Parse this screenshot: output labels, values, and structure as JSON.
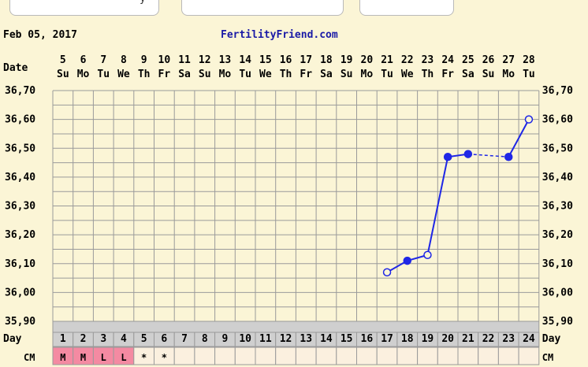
{
  "header": {
    "date": "Feb 05, 2017",
    "site": "FertilityFriend.com",
    "top_buttons": [
      {
        "label": "y"
      },
      {
        "label": ""
      },
      {
        "label": ""
      }
    ]
  },
  "chart_data": {
    "type": "line",
    "row_labels": {
      "date": "Date",
      "day": "Day",
      "cm": "CM"
    },
    "dates": [
      "5",
      "6",
      "7",
      "8",
      "9",
      "10",
      "11",
      "12",
      "13",
      "14",
      "15",
      "16",
      "17",
      "18",
      "19",
      "20",
      "21",
      "22",
      "23",
      "24",
      "25",
      "26",
      "27",
      "28"
    ],
    "weekdays": [
      "Su",
      "Mo",
      "Tu",
      "We",
      "Th",
      "Fr",
      "Sa",
      "Su",
      "Mo",
      "Tu",
      "We",
      "Th",
      "Fr",
      "Sa",
      "Su",
      "Mo",
      "Tu",
      "We",
      "Th",
      "Fr",
      "Sa",
      "Su",
      "Mo",
      "Tu"
    ],
    "days": [
      "1",
      "2",
      "3",
      "4",
      "5",
      "6",
      "7",
      "8",
      "9",
      "10",
      "11",
      "12",
      "13",
      "14",
      "15",
      "16",
      "17",
      "18",
      "19",
      "20",
      "21",
      "22",
      "23",
      "24"
    ],
    "ylim": [
      35.9,
      36.7
    ],
    "y_ticks": [
      "35,90",
      "36,00",
      "36,10",
      "36,20",
      "36,30",
      "36,40",
      "36,50",
      "36,60",
      "36,70"
    ],
    "series": [
      {
        "points": [
          {
            "day": 17,
            "temp": 36.07,
            "filled": false
          },
          {
            "day": 18,
            "temp": 36.11,
            "filled": true
          },
          {
            "day": 19,
            "temp": 36.13,
            "filled": false
          },
          {
            "day": 20,
            "temp": 36.47,
            "filled": true
          },
          {
            "day": 21,
            "temp": 36.48,
            "filled": true
          },
          {
            "day": 23,
            "temp": 36.47,
            "filled": true
          },
          {
            "day": 24,
            "temp": 36.6,
            "filled": false
          }
        ],
        "dashed_gap": [
          21,
          23
        ]
      }
    ],
    "cm": [
      "M",
      "M",
      "L",
      "L",
      "*",
      "*",
      "",
      "",
      "",
      "",
      "",
      "",
      "",
      "",
      "",
      "",
      "",
      "",
      "",
      "",
      "",
      "",
      "",
      ""
    ]
  },
  "colors": {
    "background": "#fbf5d6",
    "grid": "#9a9a9a",
    "line": "#1f27e6",
    "site_text": "#1a1aa6",
    "day_row": "#cfcfcf",
    "cm_pink": "#f48aa2",
    "cm_empty": "#fbf0df"
  }
}
